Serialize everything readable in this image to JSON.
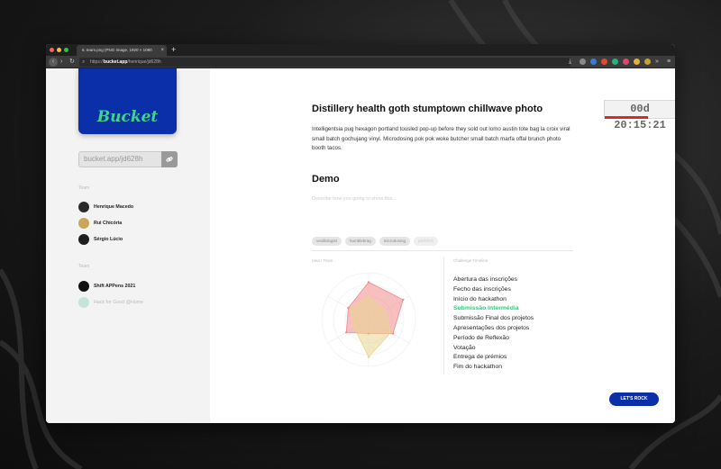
{
  "browser": {
    "tab_title": "6. team.png (PNG Image, 1920 × 1080",
    "tab_close": "×",
    "new_tab": "+",
    "url_scheme": "https://",
    "url_host": "bucket.app",
    "url_path": "/henrique/jd628h",
    "traffic_colors": [
      "#ff5f57",
      "#febc2e",
      "#28c840"
    ]
  },
  "sidebar": {
    "logo_text": "Bucket",
    "link_text": "bucket.app/jd628h",
    "link_icon": "link-icon",
    "team_label": "Team",
    "members": [
      {
        "name": "Henrique Macedo"
      },
      {
        "name": "Rui Chicória"
      },
      {
        "name": "Sérgio Lúcio"
      }
    ],
    "events_label": "Team",
    "events": [
      {
        "name": "Shift APPens 2021"
      },
      {
        "name": "Hack for Good @Home"
      }
    ]
  },
  "main": {
    "title": "Distillery health goth stumptown chillwave photo",
    "description": "Intelligentsia pug hexagon portland tousled pop-up before they sold out lomo austin tote bag la croix viral small batch gochujang vinyl. Microdosing pok pok woke butcher small batch marfa offal brunch photo booth tacos.",
    "demo_heading": "Demo",
    "demo_placeholder": "Describe how you going to show this...",
    "tags": [
      "vexillologist",
      "humblebrag",
      "microdosing",
      "pitchfork"
    ],
    "radar_label": "Idea / Team",
    "timeline_label": "Challenge Timeline",
    "timeline": [
      "Abertura das inscrições",
      "Fecho das inscrições",
      "Início do hackathon",
      "Submissão Intermédia",
      "Submissão Final dos projetos",
      "Apresentações dos projetos",
      "Período de Reflexão",
      "Votação",
      "Entrega de prémios",
      "Fim do hackathon"
    ],
    "timeline_active_index": 3,
    "cta_label": "LET'S ROCK",
    "timer": "00d 20:15:21",
    "timer_progress_pct": 62,
    "accent_color": "#0a2fa8",
    "active_color": "#2fc97c"
  },
  "chart_data": {
    "type": "radar",
    "axes": 6,
    "series": [
      {
        "values": [
          0.8,
          0.85,
          0.6,
          0.3,
          0.55,
          0.5
        ],
        "color": "#f08a8a"
      },
      {
        "values": [
          0.5,
          0.4,
          0.55,
          0.8,
          0.35,
          0.45
        ],
        "color": "#e9d590"
      }
    ]
  }
}
